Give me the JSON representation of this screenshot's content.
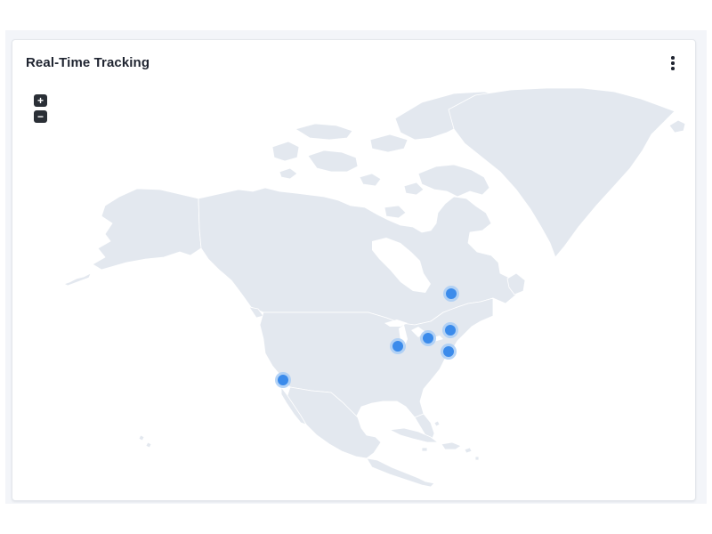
{
  "widget": {
    "title": "Real-Time Tracking",
    "menu_icon": "more-vertical-icon"
  },
  "map": {
    "region": "North America",
    "land_color": "#e3e8ef",
    "border_color": "#ffffff",
    "zoom_in_label": "+",
    "zoom_out_label": "−",
    "marker_color": "#3b8beb",
    "marker_halo_color": "#a9cdf5",
    "marker_count": 6
  }
}
